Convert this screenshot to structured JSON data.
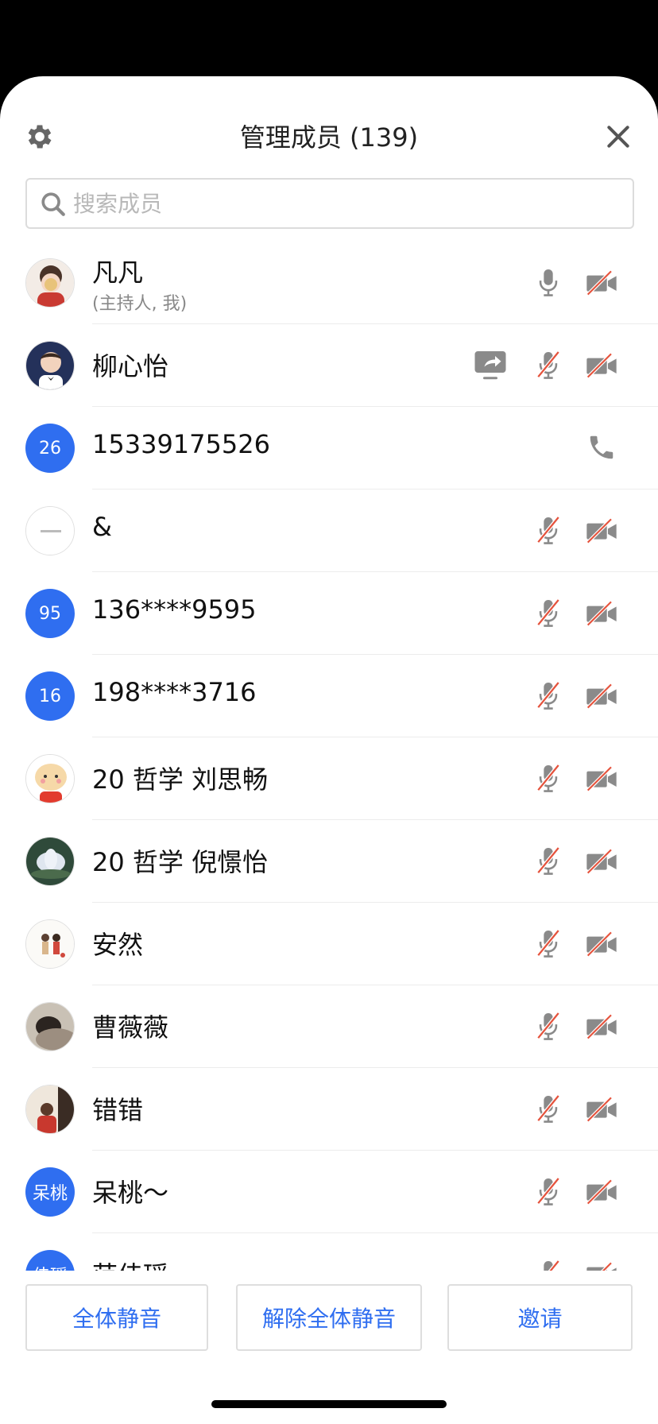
{
  "header": {
    "title": "管理成员 (139)"
  },
  "search": {
    "placeholder": "搜索成员"
  },
  "members": [
    {
      "name": "凡凡",
      "role": "(主持人, 我)",
      "avatar": "image",
      "mic": "on",
      "video": "off"
    },
    {
      "name": "柳心怡",
      "avatar": "image",
      "share": true,
      "mic": "off",
      "video": "off"
    },
    {
      "name": "15339175526",
      "avatar_text": "26",
      "phone": true
    },
    {
      "name": "&",
      "avatar": "image",
      "mic": "off",
      "video": "off"
    },
    {
      "name": "136****9595",
      "avatar_text": "95",
      "mic": "off",
      "video": "off"
    },
    {
      "name": "198****3716",
      "avatar_text": "16",
      "mic": "off",
      "video": "off"
    },
    {
      "name": "20 哲学 刘思畅",
      "avatar": "image",
      "mic": "off",
      "video": "off"
    },
    {
      "name": "20 哲学 倪憬怡",
      "avatar": "image",
      "mic": "off",
      "video": "off"
    },
    {
      "name": "安然",
      "avatar": "image",
      "mic": "off",
      "video": "off"
    },
    {
      "name": "曹薇薇",
      "avatar": "image",
      "mic": "off",
      "video": "off"
    },
    {
      "name": "错错",
      "avatar": "image",
      "mic": "off",
      "video": "off"
    },
    {
      "name": "呆桃～",
      "avatar_text": "呆桃",
      "mic": "off",
      "video": "off"
    },
    {
      "name": "范佳瑶",
      "avatar_text": "佳瑶",
      "mic": "off",
      "video": "off"
    }
  ],
  "footer": {
    "mute_all": "全体静音",
    "unmute_all": "解除全体静音",
    "invite": "邀请"
  },
  "colors": {
    "accent": "#2f6ef0",
    "muted_slash": "#e5533d",
    "icon_gray": "#8a8a8a"
  }
}
